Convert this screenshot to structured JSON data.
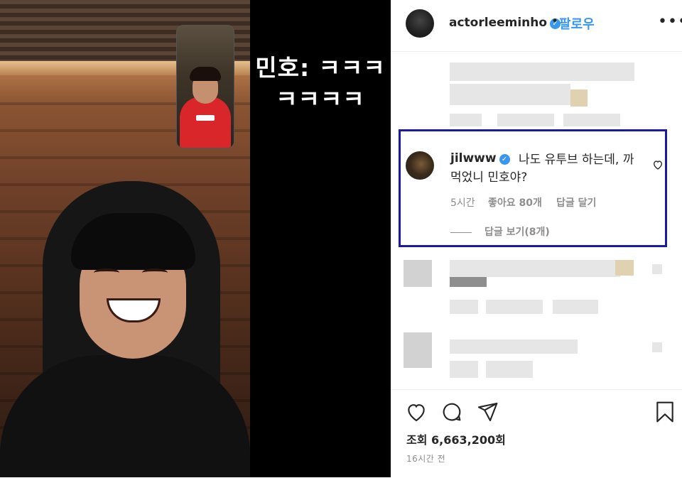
{
  "video": {
    "caption_line1": "민호: ㅋㅋㅋ",
    "caption_line2": "ㅋㅋㅋㅋ"
  },
  "header": {
    "username": "actorleeminho",
    "separator": "•",
    "follow_label": "팔로우",
    "more_label": "•••"
  },
  "highlighted_comment": {
    "username": "jilwww",
    "text": "나도 유투브 하는데, 까먹었니 민호야?",
    "time": "5시간",
    "likes": "좋아요 80개",
    "reply_label": "답글 달기",
    "view_replies": "답글 보기(8개)"
  },
  "footer": {
    "views": "조회 6,663,200회",
    "posted": "16시간 전"
  },
  "icons": {
    "like": "heart-icon",
    "comment": "comment-icon",
    "share": "send-icon",
    "save": "bookmark-icon",
    "verified": "verified-badge-icon"
  },
  "colors": {
    "link_blue": "#3897f0",
    "highlight_border": "#1a1aa8",
    "muted_text": "#8e8e8e"
  }
}
